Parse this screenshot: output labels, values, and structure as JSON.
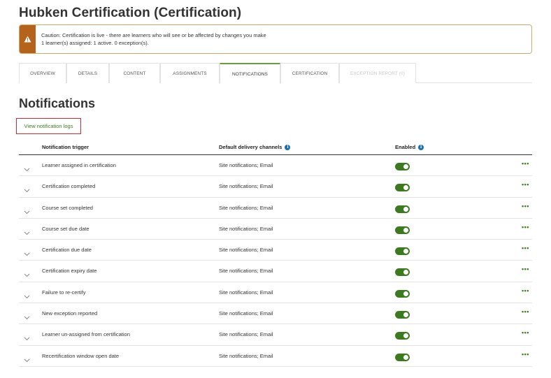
{
  "page": {
    "title": "Hubken Certification (Certification)"
  },
  "alert": {
    "icon": "warning-icon",
    "color": "#b5621b",
    "line1": "Caution: Certification is live - there are learners who will see or be affected by changes you make",
    "line2": "1 learner(s) assigned: 1 active. 0 exception(s)."
  },
  "tabs": [
    {
      "label": "OVERVIEW"
    },
    {
      "label": "DETAILS"
    },
    {
      "label": "CONTENT"
    },
    {
      "label": "ASSIGNMENTS"
    },
    {
      "label": "NOTIFICATIONS",
      "active": true
    },
    {
      "label": "CERTIFICATION"
    },
    {
      "label": "EXCEPTION REPORT (0)",
      "disabled": true
    }
  ],
  "notifications": {
    "title": "Notifications",
    "log_link": "View notification logs",
    "columns": {
      "trigger": "Notification trigger",
      "channels": "Default delivery channels",
      "enabled": "Enabled"
    },
    "rows": [
      {
        "trigger": "Learner assigned in certification",
        "channels": "Site notifications; Email",
        "enabled": true
      },
      {
        "trigger": "Certification completed",
        "channels": "Site notifications; Email",
        "enabled": true
      },
      {
        "trigger": "Course set completed",
        "channels": "Site notifications; Email",
        "enabled": true
      },
      {
        "trigger": "Course set due date",
        "channels": "Site notifications; Email",
        "enabled": true
      },
      {
        "trigger": "Certification due date",
        "channels": "Site notifications; Email",
        "enabled": true
      },
      {
        "trigger": "Certification expiry date",
        "channels": "Site notifications; Email",
        "enabled": true
      },
      {
        "trigger": "Failure to re-certify",
        "channels": "Site notifications; Email",
        "enabled": true
      },
      {
        "trigger": "New exception reported",
        "channels": "Site notifications; Email",
        "enabled": true
      },
      {
        "trigger": "Learner un-assigned from certification",
        "channels": "Site notifications; Email",
        "enabled": true
      },
      {
        "trigger": "Recertification window open date",
        "channels": "Site notifications; Email",
        "enabled": true
      }
    ],
    "more_label": "•••"
  },
  "colors": {
    "accent": "#3f7d1f",
    "toggle_on": "#3b7a1f",
    "info": "#1a6fb3",
    "highlight_border": "#d6282e"
  }
}
